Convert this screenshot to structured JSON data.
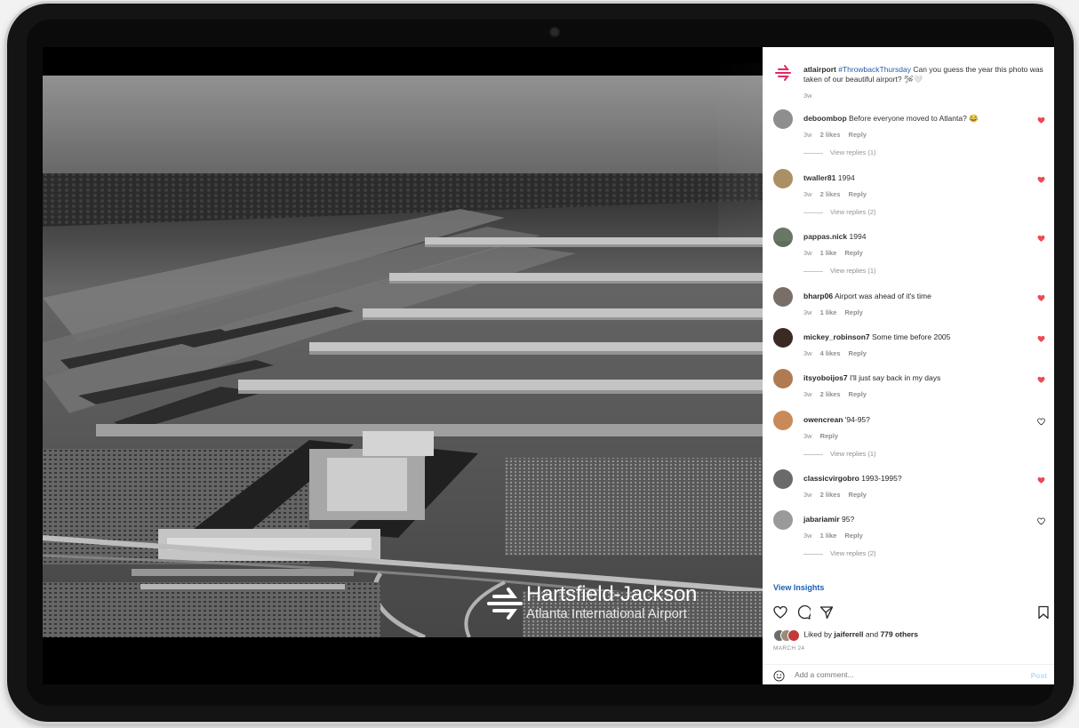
{
  "caption": {
    "username": "atlairport",
    "hashtag": "#ThrowbackThursday",
    "text": "Can you guess the year this photo was taken of our beautiful airport? 🛩🤍",
    "time": "3w"
  },
  "comments": [
    {
      "username": "deboombop",
      "text": "Before everyone moved to Atlanta? 😂",
      "time": "3w",
      "likes": "2 likes",
      "reply": "Reply",
      "view_replies": "View replies (1)",
      "liked": true,
      "avatar_color": "#8a8a8a"
    },
    {
      "username": "twaller81",
      "text": "1994",
      "time": "3w",
      "likes": "2 likes",
      "reply": "Reply",
      "view_replies": "View replies (2)",
      "liked": true,
      "avatar_color": "#a68a5c"
    },
    {
      "username": "pappas.nick",
      "text": "1994",
      "time": "3w",
      "likes": "1 like",
      "reply": "Reply",
      "view_replies": "View replies (1)",
      "liked": true,
      "avatar_color": "#5f6e5a"
    },
    {
      "username": "bharp06",
      "text": "Airport was ahead of it's time",
      "time": "3w",
      "likes": "1 like",
      "reply": "Reply",
      "view_replies": "",
      "liked": true,
      "avatar_color": "#7a6f68"
    },
    {
      "username": "mickey_robinson7",
      "text": "Some time before 2005",
      "time": "3w",
      "likes": "4 likes",
      "reply": "Reply",
      "view_replies": "",
      "liked": true,
      "avatar_color": "#3a2a22"
    },
    {
      "username": "itsyoboijos7",
      "text": "I'll just say back in my days",
      "time": "3w",
      "likes": "2 likes",
      "reply": "Reply",
      "view_replies": "",
      "liked": true,
      "avatar_color": "#b07a52"
    },
    {
      "username": "owencrean",
      "text": "'94-95?",
      "time": "3w",
      "likes": "",
      "reply": "Reply",
      "view_replies": "View replies (1)",
      "liked": false,
      "avatar_color": "#c98a5a"
    },
    {
      "username": "classicvirgobro",
      "text": "1993-1995?",
      "time": "3w",
      "likes": "2 likes",
      "reply": "Reply",
      "view_replies": "",
      "liked": true,
      "avatar_color": "#6a6a6a"
    },
    {
      "username": "jabariamir",
      "text": "95?",
      "time": "3w",
      "likes": "1 like",
      "reply": "Reply",
      "view_replies": "View replies (2)",
      "liked": false,
      "avatar_color": "#9a9a9a"
    }
  ],
  "insights_label": "View Insights",
  "liked_by": {
    "prefix": "Liked by",
    "user": "jaiferrell",
    "middle": "and",
    "others": "779 others"
  },
  "date": "MARCH 24",
  "add_comment": {
    "placeholder": "Add a comment...",
    "post_label": "Post"
  },
  "brand": {
    "title": "Hartsfield-Jackson",
    "subtitle": "Atlanta International Airport"
  },
  "colors": {
    "like_red": "#ed4956",
    "link_blue": "#1a5fb4",
    "brand_pink": "#e0245e"
  }
}
